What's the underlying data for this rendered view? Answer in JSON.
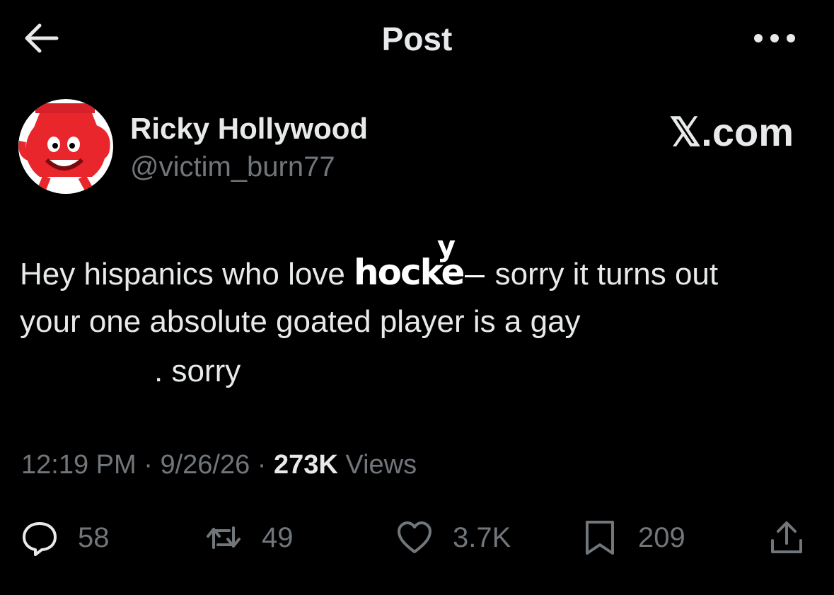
{
  "header": {
    "title": "Post",
    "back_icon": "back-arrow-icon",
    "more_icon": "more-dots-icon"
  },
  "author": {
    "name": "Ricky Hollywood",
    "handle": "@victim_burn77",
    "avatar_icon": "kool-aid-man-avatar"
  },
  "watermark": "𝕏.com",
  "post": {
    "line1_prefix": "Hey hispanics who love",
    "handwritten_word": "hocke",
    "handwritten_suffix": "y",
    "line1_suffix": "sorry it turns out",
    "line2": "your one absolute goated player is a gay",
    "line3_suffix": ". sorry"
  },
  "meta": {
    "time": "12:19 PM",
    "date": "9/26/26",
    "separator": "·",
    "views_count": "273K",
    "views_label": "Views"
  },
  "actions": {
    "replies": "58",
    "reposts": "49",
    "likes": "3.7K",
    "bookmarks": "209",
    "icons": [
      "reply-icon",
      "repost-icon",
      "like-icon",
      "bookmark-icon",
      "share-icon"
    ]
  },
  "colors": {
    "background": "#000000",
    "text": "#e7e9ea",
    "secondary": "#71767b"
  }
}
